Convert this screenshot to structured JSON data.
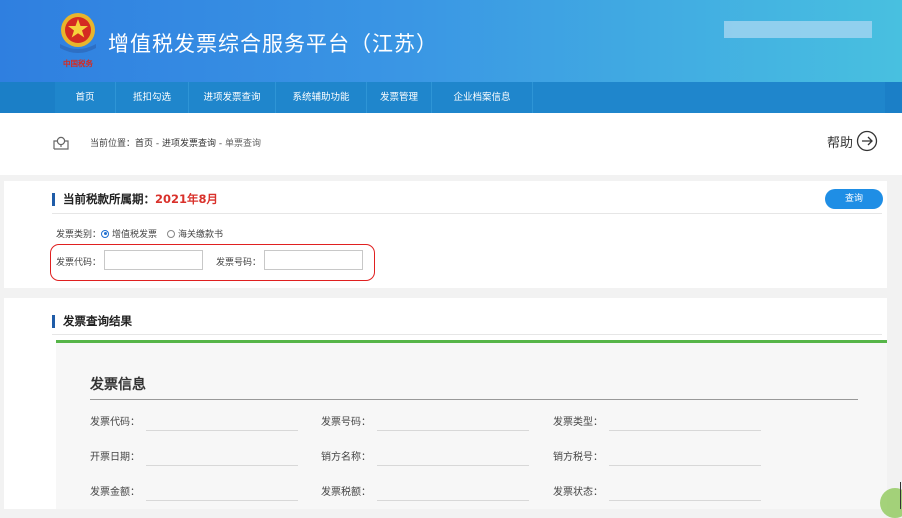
{
  "header": {
    "title": "增值税发票综合服务平台（江苏）",
    "logo_text": "中国税务",
    "brand_colors": {
      "header_start": "#2f7fe0",
      "header_end": "#48c0e0",
      "nav": "#1b7fc7"
    }
  },
  "nav": {
    "items": [
      {
        "label": "首页"
      },
      {
        "label": "抵扣勾选"
      },
      {
        "label": "进项发票查询"
      },
      {
        "label": "系统辅助功能"
      },
      {
        "label": "发票管理"
      },
      {
        "label": "企业档案信息"
      }
    ]
  },
  "breadcrumb": {
    "prefix": "当前位置：",
    "home": "首页",
    "sep1": " - ",
    "section": "进项发票查询",
    "sep2": " - ",
    "current": "单票查询",
    "icon": "location-icon"
  },
  "help": {
    "label": "帮助",
    "icon": "arrow-right-circle-icon"
  },
  "query_panel": {
    "title_prefix": "当前税款所属期：",
    "period": "2021年8月",
    "query_button": "查询",
    "invoice_type_label": "发票类别：",
    "types": [
      {
        "label": "增值税发票",
        "selected": true
      },
      {
        "label": "海关缴款书",
        "selected": false
      }
    ],
    "code_label": "发票代码：",
    "code_value": "",
    "number_label": "发票号码：",
    "number_value": ""
  },
  "results": {
    "title": "发票查询结果",
    "info_title": "发票信息",
    "fields": [
      {
        "label": "发票代码：",
        "value": ""
      },
      {
        "label": "发票号码：",
        "value": ""
      },
      {
        "label": "发票类型：",
        "value": ""
      },
      {
        "label": "开票日期：",
        "value": ""
      },
      {
        "label": "销方名称：",
        "value": ""
      },
      {
        "label": "销方税号：",
        "value": ""
      },
      {
        "label": "发票金额：",
        "value": ""
      },
      {
        "label": "发票税额：",
        "value": ""
      },
      {
        "label": "发票状态：",
        "value": ""
      }
    ]
  }
}
